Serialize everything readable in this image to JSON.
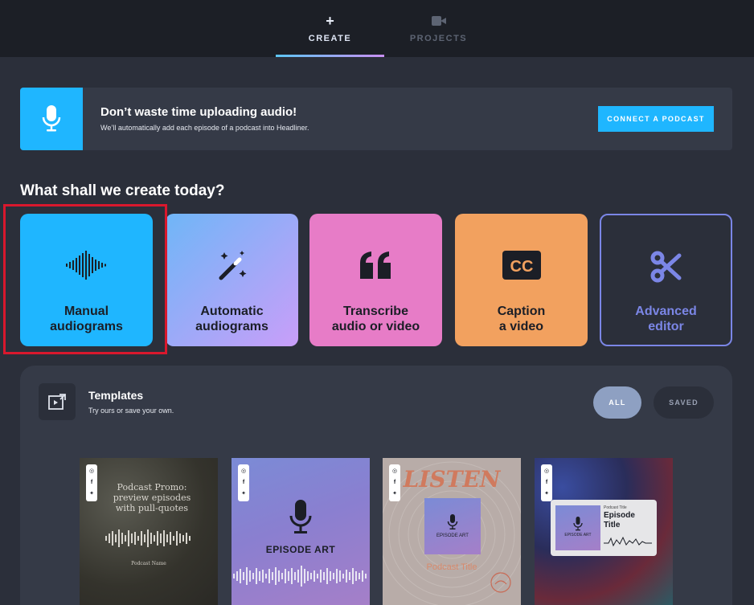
{
  "nav": {
    "tabs": [
      {
        "label": "CREATE",
        "icon": "plus-icon",
        "active": true
      },
      {
        "label": "PROJECTS",
        "icon": "video-camera-icon",
        "active": false
      }
    ],
    "plus_glyph": "+"
  },
  "banner": {
    "icon": "microphone-icon",
    "title": "Don’t waste time uploading audio!",
    "subtitle": "We’ll automatically add each episode of a podcast into Headliner.",
    "button_label": "CONNECT A PODCAST"
  },
  "create": {
    "heading": "What shall we create today?",
    "cards": [
      {
        "label": "Manual\naudiograms",
        "icon": "waveform-icon",
        "highlighted": true
      },
      {
        "label": "Automatic\naudiograms",
        "icon": "magic-wand-icon"
      },
      {
        "label": "Transcribe\naudio or video",
        "icon": "quote-icon"
      },
      {
        "label": "Caption\na video",
        "icon": "cc-icon"
      },
      {
        "label": "Advanced\neditor",
        "icon": "scissors-icon"
      }
    ]
  },
  "templates": {
    "title": "Templates",
    "subtitle": "Try ours or save your own.",
    "filters": {
      "all": "ALL",
      "saved": "SAVED",
      "selected": "all"
    },
    "thumbs": [
      {
        "title": "Podcast Promo:\npreview episodes\nwith pull-quotes",
        "footer": "Podcast Name"
      },
      {
        "art_label": "EPISODE ART"
      },
      {
        "headline": "LISTEN",
        "art_label": "EPISODE ART",
        "podcast_title": "Podcast Title"
      },
      {
        "art_label": "EPISODE ART",
        "podcast_title": "Podcast Title",
        "episode_title": "Episode\nTitle"
      }
    ],
    "social_icons": [
      "instagram-icon",
      "facebook-icon",
      "twitter-icon"
    ]
  },
  "colors": {
    "accent": "#1fb6ff",
    "highlight_border": "#d9182d",
    "advanced": "#7b86e6"
  }
}
